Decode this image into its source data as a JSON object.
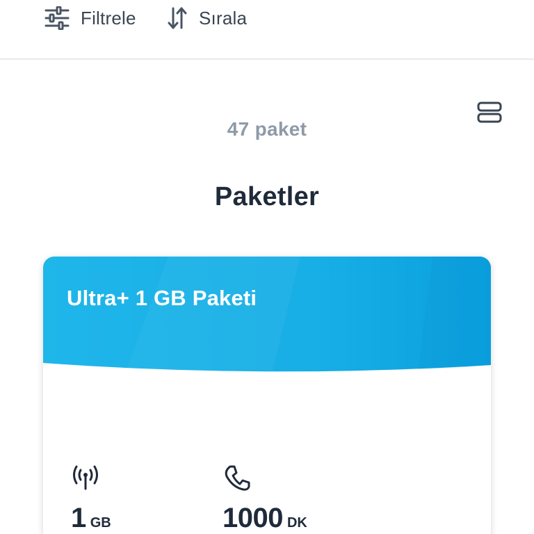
{
  "toolbar": {
    "filter_label": "Filtrele",
    "sort_label": "Sırala",
    "filter_icon": "sliders-icon",
    "sort_icon": "sort-arrows-icon"
  },
  "view_toggle_icon": "list-view-icon",
  "package_count": "47 paket",
  "page_title": "Paketler",
  "card": {
    "title": "Ultra+ 1 GB Paketi",
    "header_color": "#1ab0e6",
    "features": [
      {
        "icon": "signal-antenna-icon",
        "value": "1",
        "unit": "GB"
      },
      {
        "icon": "phone-icon",
        "value": "1000",
        "unit": "DK"
      }
    ]
  }
}
